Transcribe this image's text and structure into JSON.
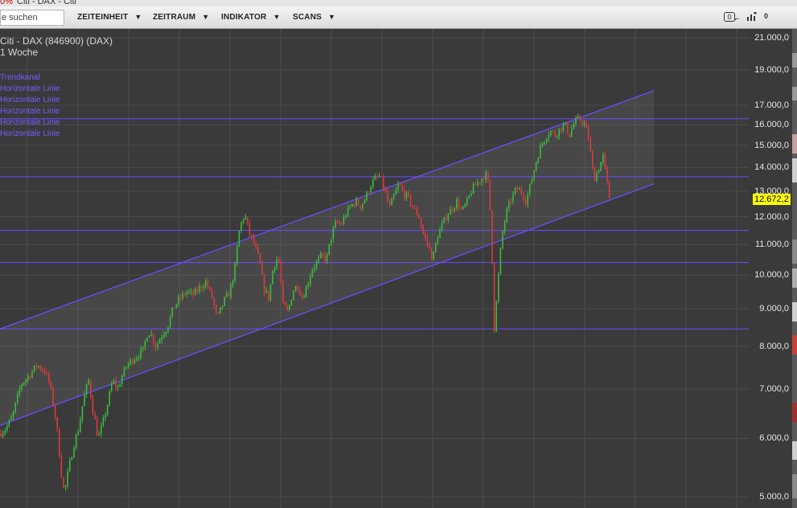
{
  "window": {
    "title_percent": "0%",
    "title": "Citi - DAX - Citi"
  },
  "toolbar": {
    "search_text": "e suchen",
    "menus": [
      {
        "label": "ZEITEINHEIT"
      },
      {
        "label": "ZEITRAUM"
      },
      {
        "label": "INDIKATOR"
      },
      {
        "label": "SCANS"
      }
    ],
    "badge_count": "0",
    "chart_icon": "chart-add-icon",
    "alert_count": "0"
  },
  "chart_info": {
    "title": "Citi - DAX (846900) (DAX)",
    "period": "1 Woche"
  },
  "legend": [
    "Trendkanal",
    "Horizontale Linie",
    "Horizontale Linie",
    "Horizontale Linie",
    "Horizontale Linie",
    "Horizontale Linie"
  ],
  "colors": {
    "background": "#3a3a3a",
    "grid": "#4a4a4a",
    "up": "#3cbc3c",
    "down": "#d83c3c",
    "lines": "#6a4cff",
    "price_tag": "#ffff00"
  },
  "chart_data": {
    "type": "candlestick",
    "title": "Citi - DAX (846900) (DAX)",
    "interval": "1 Woche",
    "y_scale": "log",
    "yticks": [
      {
        "value": 21000,
        "label": "21.000,0"
      },
      {
        "value": 19000,
        "label": "19.000,0"
      },
      {
        "value": 17000,
        "label": "17.000,0"
      },
      {
        "value": 16000,
        "label": "16.000,0"
      },
      {
        "value": 15000,
        "label": "15.000,0"
      },
      {
        "value": 14000,
        "label": "14.000,0"
      },
      {
        "value": 13000,
        "label": "13.000,0"
      },
      {
        "value": 12000,
        "label": "12.000,0"
      },
      {
        "value": 11000,
        "label": "11.000,0"
      },
      {
        "value": 10000,
        "label": "10.000,0"
      },
      {
        "value": 9000,
        "label": "9.000,0"
      },
      {
        "value": 8000,
        "label": "8.000,0"
      },
      {
        "value": 7000,
        "label": "7.000,0"
      },
      {
        "value": 6000,
        "label": "6.000,0"
      },
      {
        "value": 5000,
        "label": "5.000,0"
      }
    ],
    "last_price": 12672.2,
    "last_price_label": "12.672,2",
    "horizontal_lines": [
      16300,
      13600,
      11500,
      10400,
      8450
    ],
    "trend_channel": {
      "upper": {
        "start": 8450,
        "end": 17800
      },
      "lower": {
        "start": 6250,
        "end": 13300
      }
    },
    "path": [
      [
        0,
        6100
      ],
      [
        8,
        6200
      ],
      [
        16,
        6450
      ],
      [
        26,
        7100
      ],
      [
        36,
        7300
      ],
      [
        46,
        7550
      ],
      [
        56,
        7400
      ],
      [
        62,
        7100
      ],
      [
        70,
        6300
      ],
      [
        76,
        5400
      ],
      [
        80,
        5050
      ],
      [
        86,
        5500
      ],
      [
        92,
        5900
      ],
      [
        98,
        6200
      ],
      [
        104,
        6800
      ],
      [
        110,
        7200
      ],
      [
        116,
        6500
      ],
      [
        122,
        6000
      ],
      [
        128,
        6300
      ],
      [
        134,
        6700
      ],
      [
        140,
        7200
      ],
      [
        146,
        7000
      ],
      [
        152,
        7300
      ],
      [
        158,
        7550
      ],
      [
        166,
        7700
      ],
      [
        172,
        7800
      ],
      [
        178,
        7900
      ],
      [
        184,
        8400
      ],
      [
        188,
        8300
      ],
      [
        194,
        8000
      ],
      [
        200,
        8250
      ],
      [
        208,
        8500
      ],
      [
        216,
        9050
      ],
      [
        224,
        9300
      ],
      [
        232,
        9500
      ],
      [
        240,
        9400
      ],
      [
        248,
        9600
      ],
      [
        256,
        9800
      ],
      [
        264,
        9300
      ],
      [
        270,
        8700
      ],
      [
        278,
        9200
      ],
      [
        286,
        9500
      ],
      [
        292,
        10200
      ],
      [
        298,
        11600
      ],
      [
        304,
        12100
      ],
      [
        310,
        11400
      ],
      [
        316,
        11000
      ],
      [
        322,
        10500
      ],
      [
        328,
        9600
      ],
      [
        334,
        9300
      ],
      [
        340,
        10300
      ],
      [
        346,
        10600
      ],
      [
        352,
        9100
      ],
      [
        358,
        8900
      ],
      [
        364,
        9500
      ],
      [
        370,
        9700
      ],
      [
        376,
        9300
      ],
      [
        382,
        9700
      ],
      [
        388,
        10200
      ],
      [
        394,
        10400
      ],
      [
        400,
        10600
      ],
      [
        406,
        10500
      ],
      [
        412,
        11300
      ],
      [
        418,
        11800
      ],
      [
        424,
        11700
      ],
      [
        430,
        12100
      ],
      [
        436,
        12400
      ],
      [
        442,
        12600
      ],
      [
        448,
        12400
      ],
      [
        454,
        12700
      ],
      [
        460,
        13200
      ],
      [
        466,
        13500
      ],
      [
        472,
        13600
      ],
      [
        478,
        13100
      ],
      [
        484,
        12300
      ],
      [
        490,
        12800
      ],
      [
        496,
        13300
      ],
      [
        502,
        12900
      ],
      [
        508,
        12700
      ],
      [
        514,
        12300
      ],
      [
        520,
        12100
      ],
      [
        526,
        11400
      ],
      [
        532,
        11000
      ],
      [
        538,
        10500
      ],
      [
        544,
        11300
      ],
      [
        550,
        11700
      ],
      [
        556,
        12100
      ],
      [
        562,
        12300
      ],
      [
        568,
        12600
      ],
      [
        574,
        12200
      ],
      [
        580,
        12500
      ],
      [
        586,
        13000
      ],
      [
        592,
        13300
      ],
      [
        598,
        13500
      ],
      [
        604,
        13700
      ],
      [
        608,
        13200
      ],
      [
        612,
        10500
      ],
      [
        614,
        8300
      ],
      [
        618,
        9400
      ],
      [
        624,
        11300
      ],
      [
        630,
        12200
      ],
      [
        636,
        12700
      ],
      [
        642,
        13100
      ],
      [
        648,
        13000
      ],
      [
        654,
        12600
      ],
      [
        660,
        13300
      ],
      [
        666,
        14200
      ],
      [
        672,
        14900
      ],
      [
        678,
        15400
      ],
      [
        684,
        15700
      ],
      [
        690,
        15500
      ],
      [
        696,
        15800
      ],
      [
        702,
        16000
      ],
      [
        708,
        15500
      ],
      [
        714,
        16100
      ],
      [
        720,
        16300
      ],
      [
        726,
        16100
      ],
      [
        732,
        15300
      ],
      [
        738,
        13500
      ],
      [
        744,
        13900
      ],
      [
        750,
        14500
      ],
      [
        754,
        13500
      ],
      [
        758,
        12672
      ]
    ]
  },
  "right_strip": [
    {
      "color": "#9a9a9a",
      "top": 0.05,
      "h": 0.03
    },
    {
      "color": "#9a9a9a",
      "top": 0.12,
      "h": 0.03
    },
    {
      "color": "#c8a0a0",
      "top": 0.22,
      "h": 0.04
    },
    {
      "color": "#cfcfcf",
      "top": 0.27,
      "h": 0.05
    },
    {
      "color": "#8a8a8a",
      "top": 0.44,
      "h": 0.05
    },
    {
      "color": "#b0b0b0",
      "top": 0.5,
      "h": 0.04
    },
    {
      "color": "#cfcfcf",
      "top": 0.57,
      "h": 0.04
    },
    {
      "color": "#c84040",
      "top": 0.64,
      "h": 0.04
    },
    {
      "color": "#a03030",
      "top": 0.78,
      "h": 0.04
    },
    {
      "color": "#cfcfcf",
      "top": 0.86,
      "h": 0.04
    },
    {
      "color": "#8a8a8a",
      "top": 0.93,
      "h": 0.05
    }
  ]
}
